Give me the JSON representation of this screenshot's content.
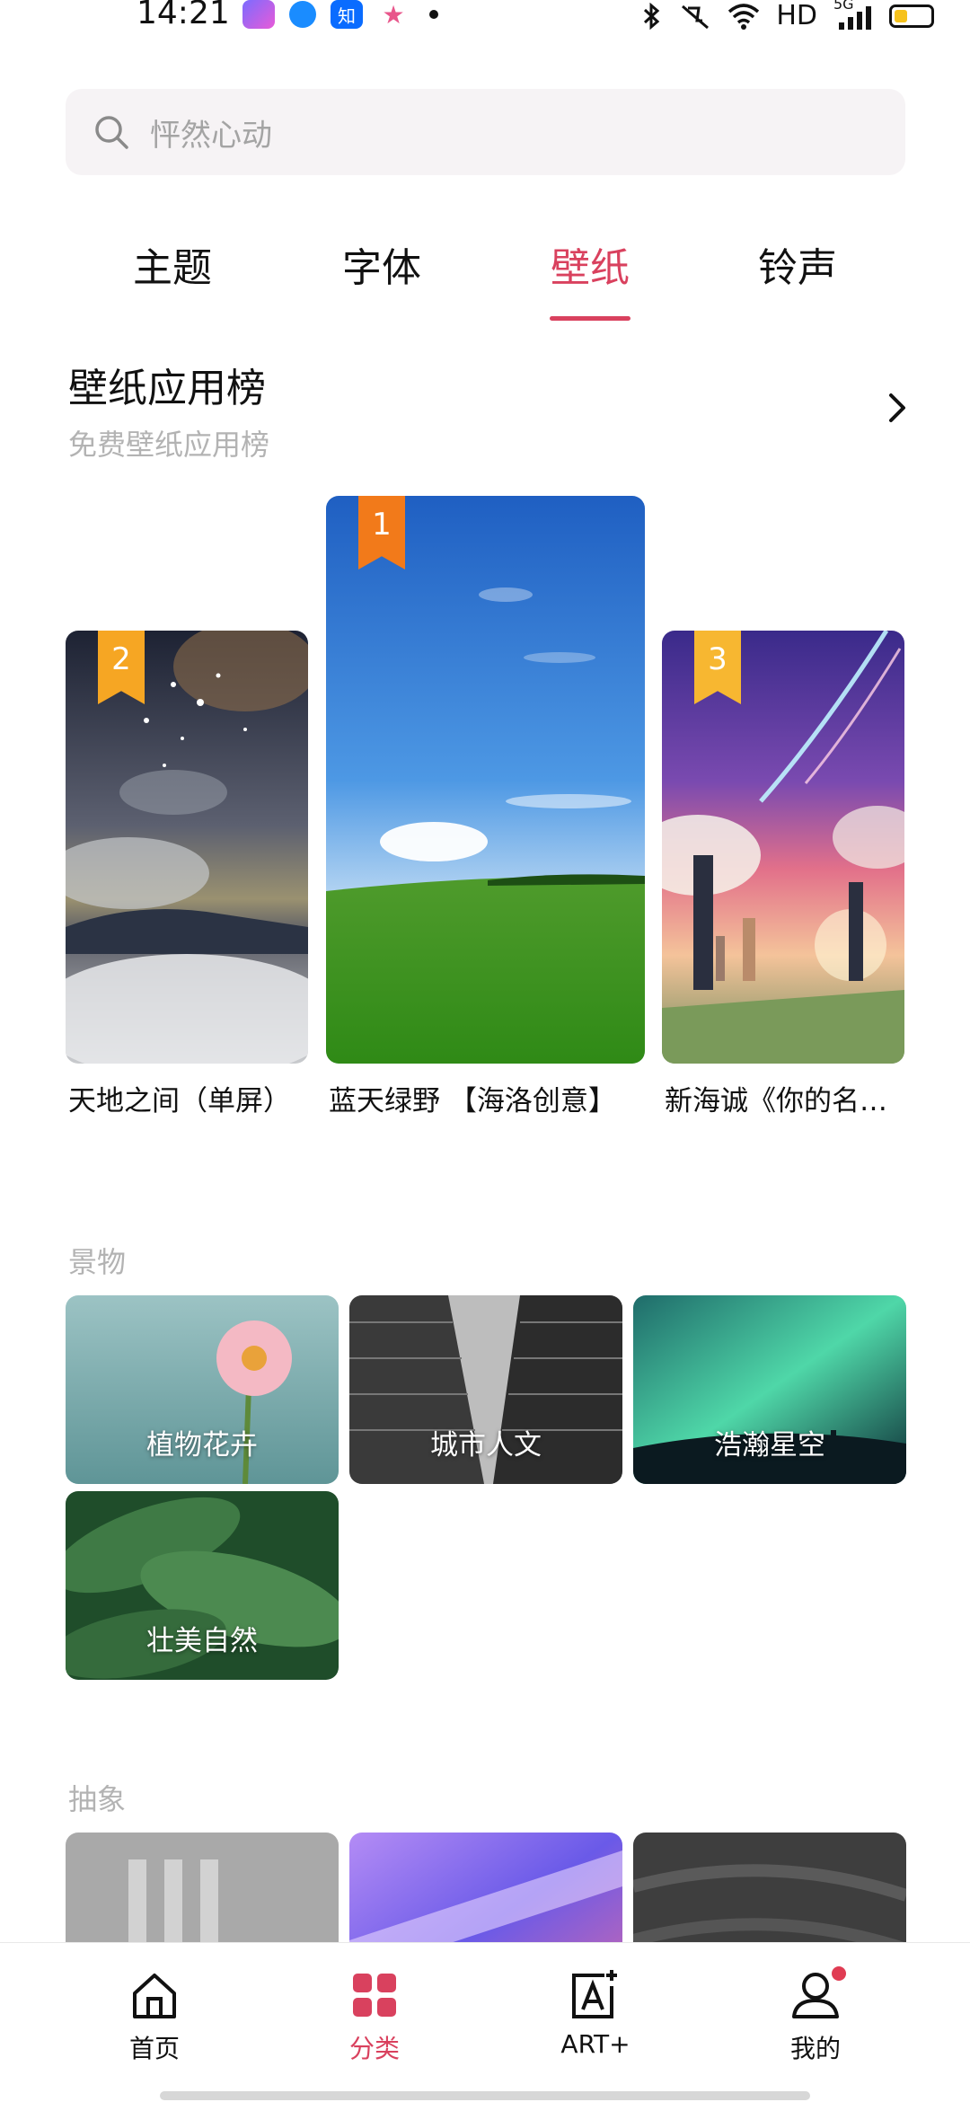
{
  "status_bar": {
    "time": "14:21",
    "app_icon_zhihu": "知",
    "network": "HD",
    "network_type": "5G",
    "icons": [
      "bluetooth-icon",
      "mute-icon",
      "wifi-icon",
      "signal-icon",
      "battery-icon"
    ]
  },
  "search": {
    "placeholder": "怦然心动"
  },
  "tabs": [
    {
      "label": "主题",
      "active": false
    },
    {
      "label": "字体",
      "active": false
    },
    {
      "label": "壁纸",
      "active": true
    },
    {
      "label": "铃声",
      "active": false
    }
  ],
  "ranking": {
    "title": "壁纸应用榜",
    "subtitle": "免费壁纸应用榜",
    "items": [
      {
        "rank": "2",
        "name": "天地之间（单屏）",
        "badge_color": "#f6a623"
      },
      {
        "rank": "1",
        "name": "蓝天绿野 【海洛创意】",
        "badge_color": "#f27a1a"
      },
      {
        "rank": "3",
        "name": "新海诚《你的名…",
        "badge_color": "#f7b731"
      }
    ]
  },
  "categories": [
    {
      "title": "景物",
      "tiles": [
        "植物花卉",
        "城市人文",
        "浩瀚星空",
        "壮美自然"
      ]
    },
    {
      "title": "抽象",
      "tiles": [
        "",
        "",
        ""
      ]
    }
  ],
  "bottom_nav": [
    {
      "label": "首页",
      "icon": "home-icon",
      "active": false
    },
    {
      "label": "分类",
      "icon": "category-grid-icon",
      "active": true
    },
    {
      "label": "ART+",
      "icon": "art-plus-icon",
      "active": false
    },
    {
      "label": "我的",
      "icon": "profile-icon",
      "active": false,
      "badge": true
    }
  ],
  "colors": {
    "accent": "#d9415e",
    "badge": "#e03c53",
    "muted_text": "#b3b3b3"
  }
}
